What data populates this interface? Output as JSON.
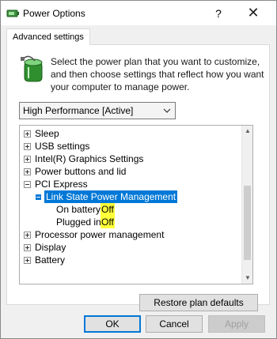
{
  "window": {
    "title": "Power Options",
    "help_glyph": "?",
    "close_glyph": "✕"
  },
  "tab": {
    "label": "Advanced settings"
  },
  "intro": {
    "text": "Select the power plan that you want to customize, and then choose settings that reflect how you want your computer to manage power."
  },
  "plan_select": {
    "value": "High Performance [Active]"
  },
  "tree": {
    "items": [
      {
        "label": "Sleep"
      },
      {
        "label": "USB settings"
      },
      {
        "label": "Intel(R) Graphics Settings"
      },
      {
        "label": "Power buttons and lid"
      },
      {
        "label": "PCI Express"
      },
      {
        "label": "Link State Power Management"
      },
      {
        "label": "On battery:",
        "value": "Off"
      },
      {
        "label": "Plugged in:",
        "value": "Off"
      },
      {
        "label": "Processor power management"
      },
      {
        "label": "Display"
      },
      {
        "label": "Battery"
      }
    ]
  },
  "buttons": {
    "restore": "Restore plan defaults",
    "ok": "OK",
    "cancel": "Cancel",
    "apply": "Apply"
  },
  "colors": {
    "selection": "#0078d7",
    "highlight": "#ffff3a"
  }
}
